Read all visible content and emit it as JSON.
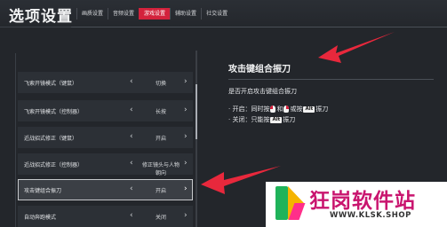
{
  "header": {
    "title": "选项设置",
    "tabs": [
      {
        "label": "画质设置",
        "active": false
      },
      {
        "label": "音频设置",
        "active": false
      },
      {
        "label": "游戏设置",
        "active": true
      },
      {
        "label": "辅助设置",
        "active": false
      },
      {
        "label": "社交设置",
        "active": false
      }
    ]
  },
  "settings": [
    {
      "label": "飞索开镜模式（键鼠）",
      "value": "切换",
      "left": "‹",
      "right": "›",
      "selected": false
    },
    {
      "label": "飞索开镜模式（控制器）",
      "value": "长按",
      "left": "‹",
      "right": "›",
      "selected": false
    },
    {
      "label": "近战招式修正（键鼠）",
      "value": "开启",
      "left": "‹",
      "right": "›",
      "selected": false
    },
    {
      "label": "近战招式修正（控制器）",
      "value": "修正镜头与人物朝向",
      "left": "‹",
      "right": "›",
      "selected": false
    },
    {
      "label": "攻击键组合振刀",
      "value": "开启",
      "left": "‹",
      "right": "›",
      "selected": true
    },
    {
      "label": "自动奔跑模式",
      "value": "关闭",
      "left": "‹",
      "right": "›",
      "selected": false
    }
  ],
  "detail": {
    "title": "攻击键组合振刀",
    "question": "是否开启攻击键组合振刀",
    "on": {
      "prefix": "· 开启：同时按",
      "and": "和",
      "or": "或按",
      "key": "Alt",
      "suffix": "振刀"
    },
    "off": {
      "prefix": "· 关闭：只能按",
      "key": "Alt",
      "suffix": "振刀"
    }
  },
  "watermark": {
    "name": "狂岗软件站",
    "url": "WWW.KLSK.SHOP"
  },
  "colors": {
    "accent": "#d3223c",
    "arrow": "#e8283c",
    "watermark_name": "#c9156f"
  }
}
